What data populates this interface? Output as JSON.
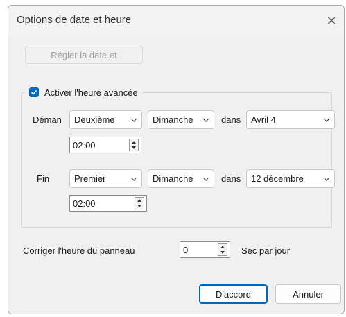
{
  "dialog": {
    "title": "Options de date et heure",
    "close_glyph": "✕"
  },
  "set_datetime_button": "Régler la date et",
  "dst": {
    "checkbox_label": "Activer l'heure avancée",
    "checked": true,
    "start_label": "Déman",
    "start_week": "Deuxième",
    "start_day": "Dimanche",
    "in_label_start": "dans",
    "start_month": "Avril 4",
    "start_time": "02:00",
    "end_label": "Fin",
    "end_week": "Premier",
    "end_day": "Dimanche",
    "in_label_end": "dans",
    "end_month": "12 décembre",
    "end_time": "02:00"
  },
  "panel_correction": {
    "label": "Corriger l'heure du panneau",
    "value": "0",
    "unit": "Sec par jour"
  },
  "buttons": {
    "ok": "D'accord",
    "cancel": "Annuler"
  },
  "colors": {
    "accent": "#0067c0",
    "background": "#f0f0f0"
  }
}
